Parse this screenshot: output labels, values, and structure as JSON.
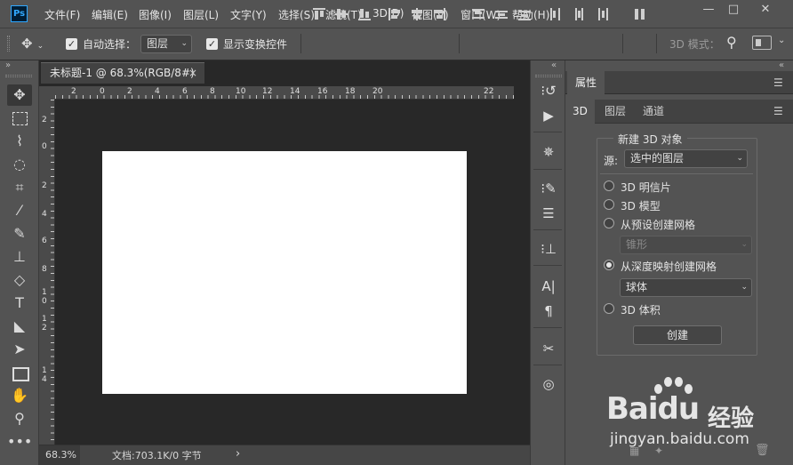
{
  "app": {
    "logo": "Ps"
  },
  "menu": [
    "文件(F)",
    "编辑(E)",
    "图像(I)",
    "图层(L)",
    "文字(Y)",
    "选择(S)",
    "滤镜(T)",
    "3D(D)",
    "视图(V)",
    "窗口(W)",
    "帮助(H)"
  ],
  "window_controls": {
    "minimize": "—",
    "maximize": "□",
    "close": "✕"
  },
  "options": {
    "auto_select_label": "自动选择：",
    "auto_select_value": "图层",
    "show_transform_label": "显示变换控件",
    "mode_3d_label": "3D 模式："
  },
  "document": {
    "tab_title": "未标题-1 @ 68.3%(RGB/8#)",
    "tab_close": "×",
    "ruler_top": [
      "2",
      "0",
      "2",
      "4",
      "6",
      "8",
      "10",
      "12",
      "14",
      "16",
      "18",
      "20",
      "22"
    ],
    "ruler_left": [
      "2",
      "0",
      "2",
      "4",
      "6",
      "8",
      "1\n0",
      "1\n2",
      "1\n4"
    ],
    "zoom": "68.3%",
    "doc_info": "文档:703.1K/0 字节",
    "status_arrow": "›"
  },
  "properties": {
    "title": "属性",
    "tabs": [
      "3D",
      "图层",
      "通道"
    ],
    "group_title": "新建 3D 对象",
    "source_label": "源:",
    "source_value": "选中的图层",
    "options": [
      "3D 明信片",
      "3D 模型",
      "从预设创建网格",
      "从深度映射创建网格",
      "3D 体积"
    ],
    "selected_option": "从深度映射创建网格",
    "preset_select": "锥形",
    "depth_select": "球体",
    "create_button": "创建"
  },
  "collapse_arrows": {
    "left": "»",
    "right": "«"
  },
  "watermark": {
    "brand": "Baidu",
    "brand_cn": "经验",
    "url": "jingyan.baidu.com"
  },
  "colors": {
    "ui_bg": "#535353",
    "doc_bg": "#282828",
    "canvas": "#ffffff",
    "ps_blue": "#31a8ff"
  }
}
